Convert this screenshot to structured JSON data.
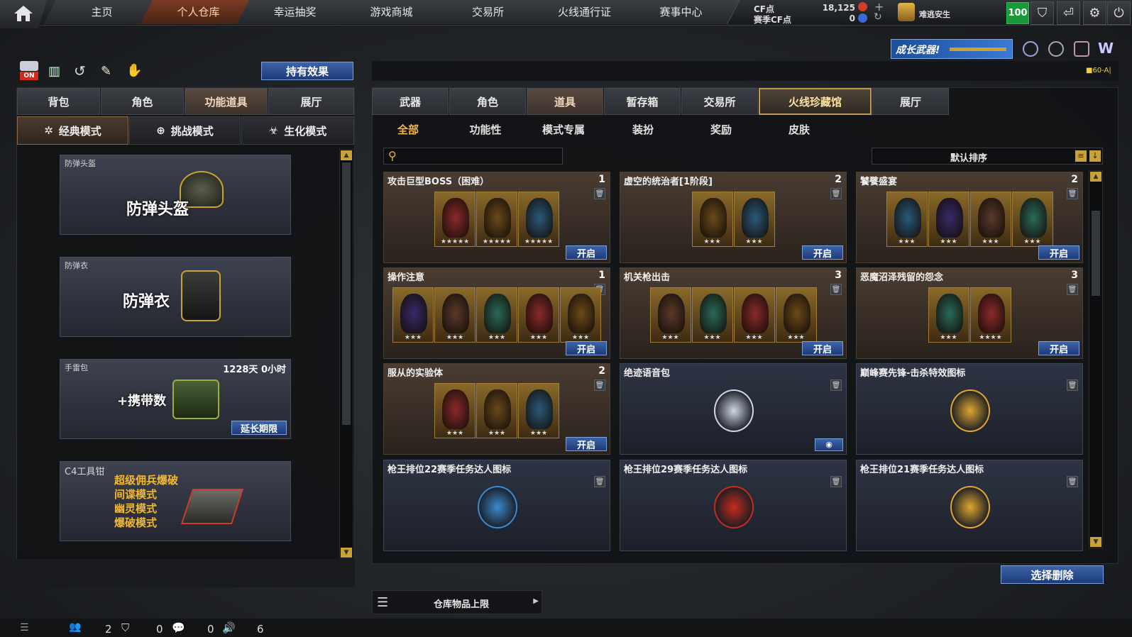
{
  "nav": {
    "tabs": [
      {
        "label": "主页"
      },
      {
        "label": "个人仓库"
      },
      {
        "label": "幸运抽奖"
      },
      {
        "label": "游戏商城"
      },
      {
        "label": "交易所"
      },
      {
        "label": "火线通行证"
      },
      {
        "label": "赛事中心"
      }
    ]
  },
  "currency": {
    "cf_label": "CF点",
    "cf_value": "18,125",
    "race_cf_label": "赛季CF点",
    "race_cf_value": "0",
    "player_name": "难逃安生",
    "level": "100"
  },
  "left": {
    "on_badge": "ON",
    "effect_button": "持有效果",
    "tabs": [
      "背包",
      "角色",
      "功能道具",
      "展厅"
    ],
    "modes": [
      "经典模式",
      "挑战模式",
      "生化模式"
    ],
    "items": [
      {
        "title": "防弹头盔",
        "big": "防弹头盔"
      },
      {
        "title": "防弹衣",
        "big": "防弹衣"
      },
      {
        "title": "手雷包",
        "big": "+携带数",
        "timer": "1228天 0小时",
        "button": "延长期限"
      },
      {
        "title": "C4工具钳",
        "lines": [
          "超级佣兵爆破",
          "间谍模式",
          "幽灵模式",
          "爆破模式"
        ]
      }
    ]
  },
  "right": {
    "banner": "成长武器!",
    "level_tag": "■60-A|",
    "tabs": [
      "武器",
      "角色",
      "道具",
      "暂存箱",
      "交易所",
      "火线珍藏馆",
      "展厅"
    ],
    "subtabs": [
      "全部",
      "功能性",
      "模式专属",
      "装扮",
      "奖励",
      "皮肤"
    ],
    "search_placeholder": "",
    "sort_label": "默认排序",
    "grid": [
      {
        "title": "攻击巨型BOSS（困难）",
        "count": "1",
        "open": "开启",
        "stars": [
          "★★★★★",
          "★★★★★",
          "★★★★★"
        ]
      },
      {
        "title": "虚空的统治者[1阶段]",
        "count": "2",
        "open": "开启",
        "stars": [
          "★★★",
          "★★★"
        ]
      },
      {
        "title": "饕餮盛宴",
        "count": "2",
        "open": "开启",
        "stars": [
          "★★★",
          "★★★",
          "★★★",
          "★★★"
        ]
      },
      {
        "title": "操作注意",
        "count": "1",
        "open": "开启",
        "stars": [
          "★★★",
          "★★★",
          "★★★",
          "★★★",
          "★★★"
        ]
      },
      {
        "title": "机关枪出击",
        "count": "3",
        "open": "开启",
        "stars": [
          "★★★",
          "★★★",
          "★★★",
          "★★★"
        ]
      },
      {
        "title": "恶魔沼泽残留的怨念",
        "count": "3",
        "open": "开启",
        "stars": [
          "★★★",
          "★★★★"
        ]
      },
      {
        "title": "服从的实验体",
        "count": "2",
        "open": "开启",
        "stars": [
          "★★★",
          "★★★",
          "★★★"
        ]
      },
      {
        "title": "绝迹语音包",
        "count": "",
        "open": "",
        "stars": []
      },
      {
        "title": "巅峰赛先锋-击杀特效图标",
        "count": "",
        "open": "",
        "stars": []
      },
      {
        "title": "枪王排位22赛季任务达人图标",
        "count": "",
        "open": "",
        "stars": []
      },
      {
        "title": "枪王排位29赛季任务达人图标",
        "count": "",
        "open": "",
        "stars": []
      },
      {
        "title": "枪王排位21赛季任务达人图标",
        "count": "",
        "open": "",
        "stars": []
      }
    ],
    "delete_button": "选择删除",
    "capacity_label": "仓库物品上限"
  },
  "status": {
    "v1": "2",
    "v2": "0",
    "v3": "0",
    "v4": "6"
  },
  "colors": {
    "accent": "#f7b847",
    "open_button": "#2c4f94",
    "level": "#189a3a"
  }
}
